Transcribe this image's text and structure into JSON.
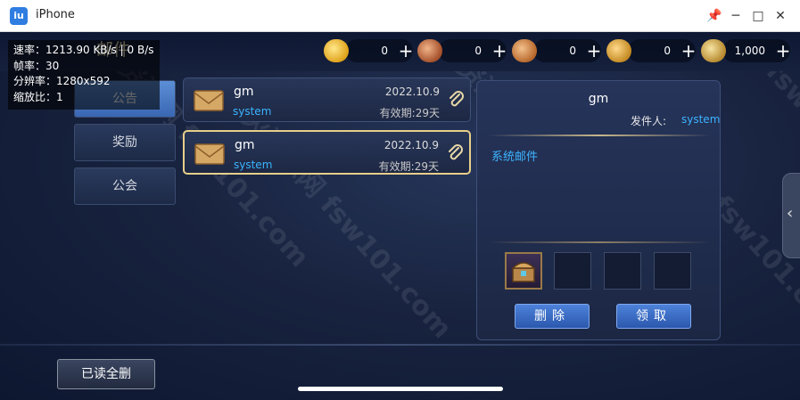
{
  "window": {
    "app_icon": "iu",
    "title": "iPhone",
    "pin_icon": "📌",
    "minimize_icon": "─",
    "maximize_icon": "□",
    "close_icon": "✕"
  },
  "header": {
    "title": "邮件"
  },
  "resources": [
    {
      "icon": "gold-ingot-icon",
      "value": "0",
      "plus": "+"
    },
    {
      "icon": "red-scroll-icon",
      "value": "0",
      "plus": "+"
    },
    {
      "icon": "locked-scroll-icon",
      "value": "0",
      "plus": "+"
    },
    {
      "icon": "coin-icon",
      "value": "0",
      "plus": "+"
    },
    {
      "icon": "coin-stack-icon",
      "value": "1,000",
      "plus": "+"
    }
  ],
  "stats": {
    "speed": "速率：1213.90 KB/s | 0 B/s",
    "fps": "帧率：30",
    "resolution": "分辨率：1280x592",
    "scale": "缩放比：1"
  },
  "tabs": [
    "公告",
    "奖励",
    "公会"
  ],
  "mails": [
    {
      "sender": "gm",
      "subject": "system",
      "date": "2022.10.9",
      "expiry": "有效期:29天"
    },
    {
      "sender": "gm",
      "subject": "system",
      "date": "2022.10.9",
      "expiry": "有效期:29天"
    }
  ],
  "detail": {
    "sender": "gm",
    "from_label": "发件人:",
    "from_value": "system",
    "content": "系统邮件",
    "delete_button": "删除",
    "claim_button": "领取"
  },
  "footer": {
    "read_all_delete": "已读全删"
  },
  "side_handle": {
    "icon": "‹"
  },
  "watermark": "星火资源网 fsw101.com"
}
